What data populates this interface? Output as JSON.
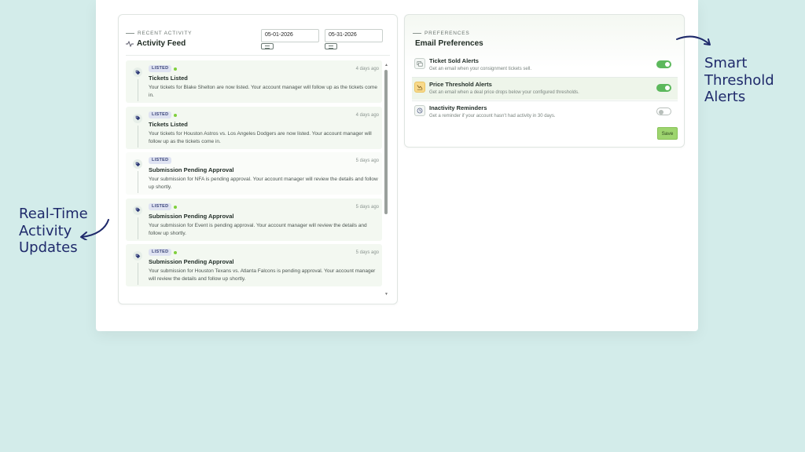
{
  "activity": {
    "eyebrow": "RECENT ACTIVITY",
    "title": "Activity Feed",
    "date_from": "05-01-2026",
    "date_to": "05-31-2026",
    "items": [
      {
        "badge": "LISTED",
        "title": "Tickets Listed",
        "when": "4 days ago",
        "body": "Your tickets for Blake Shelton are now listed. Your account manager will follow up as the tickets come in."
      },
      {
        "badge": "LISTED",
        "title": "Tickets Listed",
        "when": "4 days ago",
        "body": "Your tickets for Houston Astros vs. Los Angeles Dodgers are now listed. Your account manager will follow up as the tickets come in."
      },
      {
        "badge": "LISTED",
        "title": "Submission Pending Approval",
        "when": "5 days ago",
        "body": "Your submission for NFA is pending approval. Your account manager will review the details and follow up shortly."
      },
      {
        "badge": "LISTED",
        "title": "Submission Pending Approval",
        "when": "5 days ago",
        "body": "Your submission for Event is pending approval. Your account manager will review the details and follow up shortly."
      },
      {
        "badge": "LISTED",
        "title": "Submission Pending Approval",
        "when": "5 days ago",
        "body": "Your submission for Houston Texans vs. Atlanta Falcons is pending approval. Your account manager will review the details and follow up shortly."
      }
    ]
  },
  "preferences": {
    "eyebrow": "PREFERENCES",
    "title": "Email Preferences",
    "items": [
      {
        "name": "Ticket Sold Alerts",
        "desc": "Get an email when your consignment tickets sell.",
        "enabled": true,
        "icon": "ticket-icon"
      },
      {
        "name": "Price Threshold Alerts",
        "desc": "Get an email when a deal price drops below your configured thresholds.",
        "enabled": true,
        "icon": "chart-down-icon"
      },
      {
        "name": "Inactivity Reminders",
        "desc": "Get a reminder if your account hasn't had activity in 30 days.",
        "enabled": false,
        "icon": "clock-icon"
      }
    ],
    "save_label": "Save"
  },
  "callouts": {
    "right": [
      "Smart",
      "Threshold",
      "Alerts"
    ],
    "left": [
      "Real-Time",
      "Activity",
      "Updates"
    ]
  },
  "colors": {
    "background": "#d3ecea",
    "accent_green": "#5cb85c",
    "callout_text": "#1f2a6b",
    "badge_bg": "#dfe3f2"
  }
}
